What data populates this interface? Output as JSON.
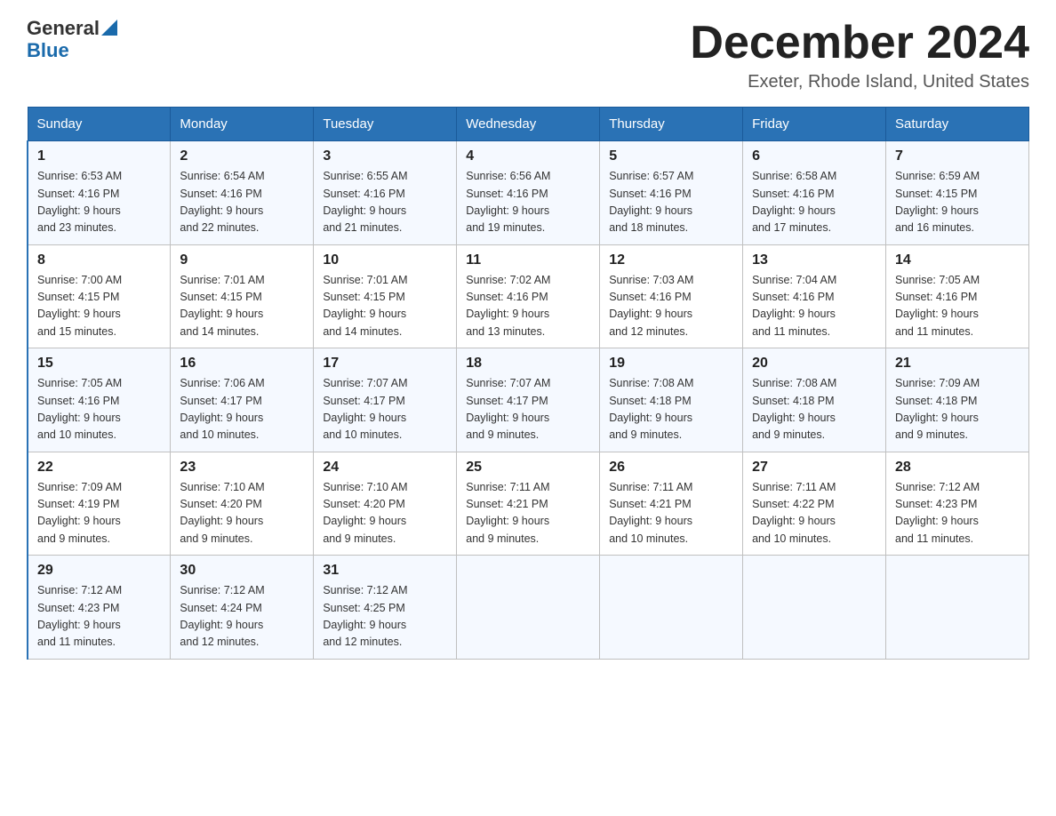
{
  "header": {
    "title": "December 2024",
    "location": "Exeter, Rhode Island, United States",
    "logo_general": "General",
    "logo_blue": "Blue"
  },
  "days_of_week": [
    "Sunday",
    "Monday",
    "Tuesday",
    "Wednesday",
    "Thursday",
    "Friday",
    "Saturday"
  ],
  "weeks": [
    [
      {
        "day": "1",
        "sunrise": "6:53 AM",
        "sunset": "4:16 PM",
        "daylight": "9 hours and 23 minutes."
      },
      {
        "day": "2",
        "sunrise": "6:54 AM",
        "sunset": "4:16 PM",
        "daylight": "9 hours and 22 minutes."
      },
      {
        "day": "3",
        "sunrise": "6:55 AM",
        "sunset": "4:16 PM",
        "daylight": "9 hours and 21 minutes."
      },
      {
        "day": "4",
        "sunrise": "6:56 AM",
        "sunset": "4:16 PM",
        "daylight": "9 hours and 19 minutes."
      },
      {
        "day": "5",
        "sunrise": "6:57 AM",
        "sunset": "4:16 PM",
        "daylight": "9 hours and 18 minutes."
      },
      {
        "day": "6",
        "sunrise": "6:58 AM",
        "sunset": "4:16 PM",
        "daylight": "9 hours and 17 minutes."
      },
      {
        "day": "7",
        "sunrise": "6:59 AM",
        "sunset": "4:15 PM",
        "daylight": "9 hours and 16 minutes."
      }
    ],
    [
      {
        "day": "8",
        "sunrise": "7:00 AM",
        "sunset": "4:15 PM",
        "daylight": "9 hours and 15 minutes."
      },
      {
        "day": "9",
        "sunrise": "7:01 AM",
        "sunset": "4:15 PM",
        "daylight": "9 hours and 14 minutes."
      },
      {
        "day": "10",
        "sunrise": "7:01 AM",
        "sunset": "4:15 PM",
        "daylight": "9 hours and 14 minutes."
      },
      {
        "day": "11",
        "sunrise": "7:02 AM",
        "sunset": "4:16 PM",
        "daylight": "9 hours and 13 minutes."
      },
      {
        "day": "12",
        "sunrise": "7:03 AM",
        "sunset": "4:16 PM",
        "daylight": "9 hours and 12 minutes."
      },
      {
        "day": "13",
        "sunrise": "7:04 AM",
        "sunset": "4:16 PM",
        "daylight": "9 hours and 11 minutes."
      },
      {
        "day": "14",
        "sunrise": "7:05 AM",
        "sunset": "4:16 PM",
        "daylight": "9 hours and 11 minutes."
      }
    ],
    [
      {
        "day": "15",
        "sunrise": "7:05 AM",
        "sunset": "4:16 PM",
        "daylight": "9 hours and 10 minutes."
      },
      {
        "day": "16",
        "sunrise": "7:06 AM",
        "sunset": "4:17 PM",
        "daylight": "9 hours and 10 minutes."
      },
      {
        "day": "17",
        "sunrise": "7:07 AM",
        "sunset": "4:17 PM",
        "daylight": "9 hours and 10 minutes."
      },
      {
        "day": "18",
        "sunrise": "7:07 AM",
        "sunset": "4:17 PM",
        "daylight": "9 hours and 9 minutes."
      },
      {
        "day": "19",
        "sunrise": "7:08 AM",
        "sunset": "4:18 PM",
        "daylight": "9 hours and 9 minutes."
      },
      {
        "day": "20",
        "sunrise": "7:08 AM",
        "sunset": "4:18 PM",
        "daylight": "9 hours and 9 minutes."
      },
      {
        "day": "21",
        "sunrise": "7:09 AM",
        "sunset": "4:18 PM",
        "daylight": "9 hours and 9 minutes."
      }
    ],
    [
      {
        "day": "22",
        "sunrise": "7:09 AM",
        "sunset": "4:19 PM",
        "daylight": "9 hours and 9 minutes."
      },
      {
        "day": "23",
        "sunrise": "7:10 AM",
        "sunset": "4:20 PM",
        "daylight": "9 hours and 9 minutes."
      },
      {
        "day": "24",
        "sunrise": "7:10 AM",
        "sunset": "4:20 PM",
        "daylight": "9 hours and 9 minutes."
      },
      {
        "day": "25",
        "sunrise": "7:11 AM",
        "sunset": "4:21 PM",
        "daylight": "9 hours and 9 minutes."
      },
      {
        "day": "26",
        "sunrise": "7:11 AM",
        "sunset": "4:21 PM",
        "daylight": "9 hours and 10 minutes."
      },
      {
        "day": "27",
        "sunrise": "7:11 AM",
        "sunset": "4:22 PM",
        "daylight": "9 hours and 10 minutes."
      },
      {
        "day": "28",
        "sunrise": "7:12 AM",
        "sunset": "4:23 PM",
        "daylight": "9 hours and 11 minutes."
      }
    ],
    [
      {
        "day": "29",
        "sunrise": "7:12 AM",
        "sunset": "4:23 PM",
        "daylight": "9 hours and 11 minutes."
      },
      {
        "day": "30",
        "sunrise": "7:12 AM",
        "sunset": "4:24 PM",
        "daylight": "9 hours and 12 minutes."
      },
      {
        "day": "31",
        "sunrise": "7:12 AM",
        "sunset": "4:25 PM",
        "daylight": "9 hours and 12 minutes."
      },
      null,
      null,
      null,
      null
    ]
  ],
  "labels": {
    "sunrise": "Sunrise:",
    "sunset": "Sunset:",
    "daylight": "Daylight:"
  }
}
